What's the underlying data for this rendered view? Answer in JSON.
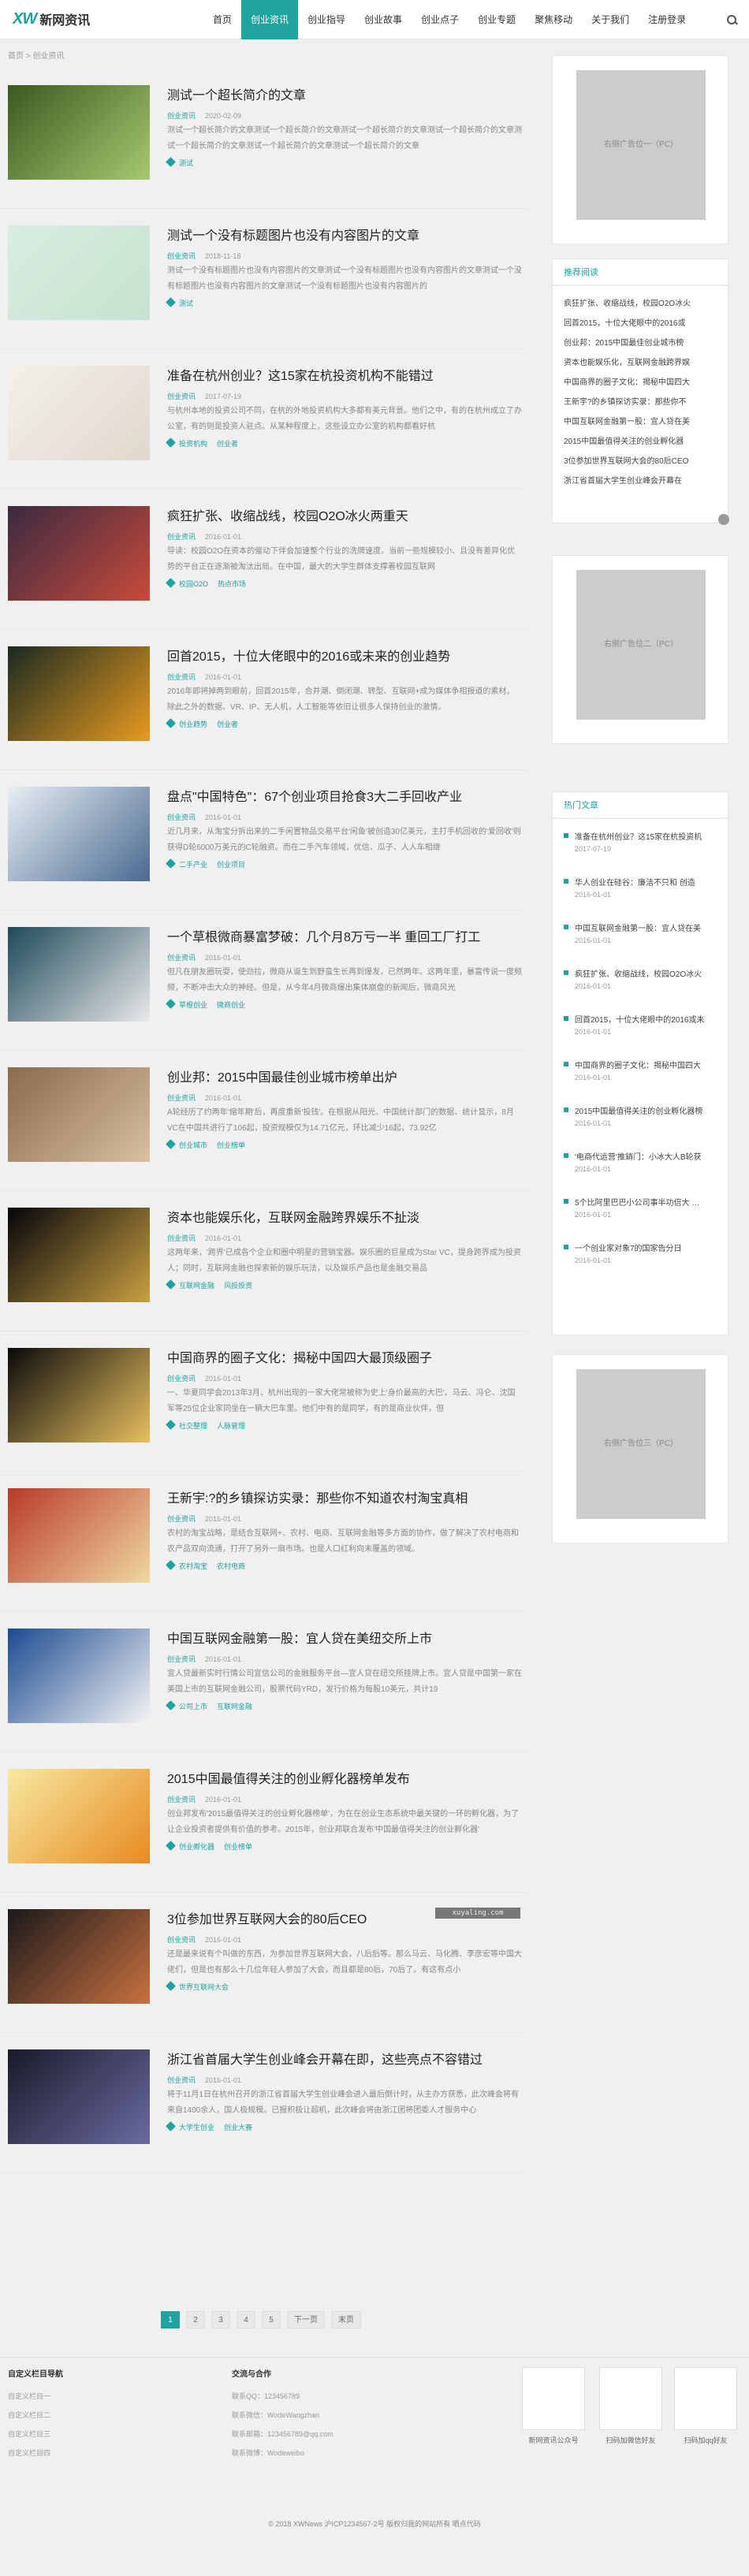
{
  "header": {
    "logo_mark": "XW",
    "logo_text": "新网资讯",
    "nav": [
      "首页",
      "创业资讯",
      "创业指导",
      "创业故事",
      "创业点子",
      "创业专题",
      "聚焦移动",
      "关于我们",
      "注册登录"
    ],
    "active_index": 1
  },
  "breadcrumb": "首页 > 创业资讯",
  "articles": [
    {
      "title": "测试一个超长简介的文章",
      "cat": "创业资讯",
      "date": "2020-02-09",
      "excerpt": "测试一个超长简介的文章测试一个超长简介的文章测试一个超长简介的文章测试一个超长简介的文章测试一个超长简介的文章测试一个超长简介的文章测试一个超长简介的文章",
      "tags": [
        "测试"
      ]
    },
    {
      "title": "测试一个没有标题图片也没有内容图片的文章",
      "cat": "创业资讯",
      "date": "2018-11-18",
      "excerpt": "测试一个没有标题图片也没有内容图片的文章测试一个没有标题图片也没有内容图片的文章测试一个没有标题图片也没有内容图片的文章测试一个没有标题图片也没有内容图片的",
      "tags": [
        "测试"
      ]
    },
    {
      "title": "准备在杭州创业？这15家在杭投资机构不能错过",
      "cat": "创业资讯",
      "date": "2017-07-19",
      "excerpt": "与杭州本地的投资公司不同，在杭的外地投资机构大多都有美元背景。他们之中，有的在杭州成立了办公室，有的则是投资人驻点。从某种程度上，这些设立办公室的机构都看好杭",
      "tags": [
        "投资机构",
        "创业者"
      ]
    },
    {
      "title": "疯狂扩张、收缩战线，校园O2O冰火两重天",
      "cat": "创业资讯",
      "date": "2016-01-01",
      "excerpt": "导读：校园O2O在资本的催动下伴会加速整个行业的洗牌速度。当前一些规模较小、且没有差异化优势的平台正在逐渐被淘汰出局。在中国，最大的大学生群体支撑着校园互联网",
      "tags": [
        "校园O2O",
        "热点市场"
      ]
    },
    {
      "title": "回首2015，十位大佬眼中的2016或未来的创业趋势",
      "cat": "创业资讯",
      "date": "2016-01-01",
      "excerpt": "2016年即将掉两到眼前，回首2015年，合并潮、倒闭潮、转型、互联网+成为媒体争相报道的素材。除此之外的数据、VR、IP、无人机，人工智能等依旧让很多人保持创业的激情。",
      "tags": [
        "创业趋势",
        "创业者"
      ]
    },
    {
      "title": "盘点\"中国特色\"：67个创业项目抢食3大二手回收产业",
      "cat": "创业资讯",
      "date": "2016-01-01",
      "excerpt": "近几月来，从淘宝分拆出来的二手闲置物品交易平台'闲鱼'被创造30亿美元，主打手机回收的'爱回收'则获得D轮6000万美元的C轮融资。而在二手汽车领域，优信、瓜子、人人车相继",
      "tags": [
        "二手产业",
        "创业项目"
      ]
    },
    {
      "title": "一个草根微商暴富梦破：几个月8万亏一半 重回工厂打工",
      "cat": "创业资讯",
      "date": "2016-01-01",
      "excerpt": "但凡在朋友圈玩耍，使劲拉，微商从诞生到野蛮生长再到爆发，已然两年。这两年里，暴富传说一度频频，不断冲击大众的神经。但是，从今年4月微商爆出集体崩盘的新闻后，微商风光",
      "tags": [
        "草根创业",
        "微商创业"
      ]
    },
    {
      "title": "创业邦：2015中国最佳创业城市榜单出炉",
      "cat": "创业资讯",
      "date": "2016-01-01",
      "excerpt": "A轮经历了约两年'缩年期'后，再度重新'投钱'。在根据从阳光、中国统计部门的数据、统计显示，8月VC在中国共进行了106起，投资规模仅为14.71亿元，环比减少16起，73.92亿",
      "tags": [
        "创业城市",
        "创业榜单"
      ]
    },
    {
      "title": "资本也能娱乐化，互联网金融跨界娱乐不扯淡",
      "cat": "创业资讯",
      "date": "2016-01-01",
      "excerpt": "这两年来，'跨界'已成各个企业和圈中明星的营销宝器。娱乐圈的巨星成为Star VC，提身跨界成为投资人；同时，互联网金融也探索新的娱乐玩法，以及娱乐产品也是金融交易品",
      "tags": [
        "互联网金融",
        "风投投资"
      ]
    },
    {
      "title": "中国商界的圈子文化：揭秘中国四大最顶级圈子",
      "cat": "创业资讯",
      "date": "2016-01-01",
      "excerpt": "一、华夏同学会2013年3月，杭州出现的一家大佬常被称为史上'身价最高的大巴'。马云、冯仑、沈国军等25位企业家同坐在一辆大巴车里。他们中有的是同学，有的是商业伙伴，但",
      "tags": [
        "社交整理",
        "人脉管理"
      ]
    },
    {
      "title": "王新宇:?的乡镇探访实录：那些你不知道农村淘宝真相",
      "cat": "创业资讯",
      "date": "2016-01-01",
      "excerpt": "农村的淘宝战略，是结合互联网+、农村、电商、互联网金融等多方面的协作，做了解决了农村电商和农产品双向流通，打开了另外一扇市场。也是人口红利向未覆盖的领域。",
      "tags": [
        "农村淘宝",
        "农村电商"
      ]
    },
    {
      "title": "中国互联网金融第一股：宜人贷在美纽交所上市",
      "cat": "创业资讯",
      "date": "2016-01-01",
      "excerpt": "宜人贷最新实时行情公司宜信公司的金融服务平台—宜人贷在纽交所挂牌上市。宜人贷是中国第一家在美国上市的互联网金融公司，股票代码YRD，发行价格为每股10美元，共计19",
      "tags": [
        "公司上市",
        "互联网金融"
      ]
    },
    {
      "title": "2015中国最值得关注的创业孵化器榜单发布",
      "cat": "创业资讯",
      "date": "2016-01-01",
      "excerpt": "创业邦发布'2015最值得关注的创业孵化器榜单'，为在在创业生态系统中最关键的一环的孵化器，为了让企业投资者提供有价值的参考。2015年，创业邦联合发布'中国最值得关注的创业孵化器'",
      "tags": [
        "创业孵化器",
        "创业榜单"
      ]
    },
    {
      "title": "3位参加世界互联网大会的80后CEO",
      "cat": "创业资讯",
      "date": "2016-01-01",
      "excerpt": "还是最来说有个叫做的东西，为参加世界互联网大会，八后后等。那么马云、马化腾、李彦宏等中国大佬们，但是也有那么十几位年轻人参加了大会，而且都是80后，70后了。有这有点小",
      "tags": [
        "世界互联网大会"
      ]
    },
    {
      "title": "浙江省首届大学生创业峰会开幕在即，这些亮点不容错过",
      "cat": "创业资讯",
      "date": "2016-01-01",
      "excerpt": "将于11月1日在杭州召开的浙江省首届大学生创业峰会进入最后倒计时，从主办方获悉，此次峰会将有来自1400余人，国人极规模。已报积极让超机，此次峰会将由浙江团将团委人才服务中心",
      "tags": [
        "大学生创业",
        "创业大赛"
      ]
    }
  ],
  "pager": [
    "1",
    "2",
    "3",
    "4",
    "5",
    "下一页",
    "末页"
  ],
  "sidebar": {
    "ad1": "右侧广告位一（PC）",
    "ad2": "右侧广告位二（PC）",
    "ad3": "右侧广告位三（PC）",
    "rec_title": "推荐阅读",
    "rec": [
      "疯狂扩张、收缩战线，校园O2O冰火",
      "回首2015，十位大佬眼中的2016或",
      "创业邦：2015中国最佳创业城市榜",
      "资本也能娱乐化，互联网金融跨界娱",
      "中国商界的圈子文化：揭秘中国四大",
      "王新宇?的乡镇探访实录：那些你不",
      "中国互联网金融第一股：宜人贷在美",
      "2015中国最值得关注的创业孵化器",
      "3位参加世界互联网大会的80后CEO",
      "浙江省首届大学生创业峰会开幕在"
    ],
    "hot_title": "热门文章",
    "hot": [
      {
        "t": "准备在杭州创业？这15家在杭投资机",
        "d": "2017-07-19"
      },
      {
        "t": "华人创业在硅谷：廉洁不只和 创造",
        "d": "2016-01-01"
      },
      {
        "t": "中国互联网金融第一股：宜人贷在美",
        "d": "2016-01-01"
      },
      {
        "t": "疯狂扩张、收缩战线，校园O2O冰火",
        "d": "2016-01-01"
      },
      {
        "t": "回首2015，十位大佬眼中的2016或未",
        "d": "2016-01-01"
      },
      {
        "t": "中国商界的圈子文化：揭秘中国四大",
        "d": "2016-01-01"
      },
      {
        "t": "2015中国最值得关注的创业孵化器榜",
        "d": "2016-01-01"
      },
      {
        "t": "'电商代运营'推銷门：小冰大人B轮获",
        "d": "2016-01-01"
      },
      {
        "t": "5个比阿里巴巴小公司事半功倍大 …",
        "d": "2016-01-01"
      },
      {
        "t": "一个创业家对象7的国家告分日",
        "d": "2016-01-01"
      }
    ]
  },
  "footer": {
    "col1_title": "自定义栏目导航",
    "col1": [
      "自定义栏目一",
      "自定义栏目二",
      "自定义栏目三",
      "自定义栏目四"
    ],
    "col2_title": "交流与合作",
    "col2": [
      "联系QQ：123456789",
      "联系微信：WodeWangzhan",
      "联系邮箱：123456789@qq.com",
      "联系微博：Wodeweibo"
    ],
    "qr": [
      "新网资讯公众号",
      "扫码加微信好友",
      "扫码加qq好友"
    ],
    "copyright": "© 2018 XWNews  沪ICP1234567-2号  版权归我的网站所有  晒点代码"
  },
  "watermark": "xuyaling.com"
}
